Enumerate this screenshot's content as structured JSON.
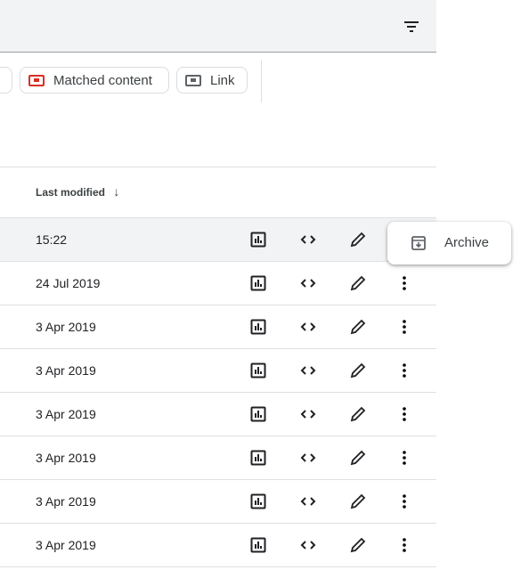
{
  "filters": {
    "chips": [
      {
        "label": "Matched content",
        "color": "#d93025"
      },
      {
        "label": "Link",
        "color": "#5f6368"
      }
    ]
  },
  "table": {
    "column_header": "Last modified",
    "sort": "descending",
    "rows": [
      {
        "date": "15:22"
      },
      {
        "date": "24 Jul 2019"
      },
      {
        "date": "3 Apr 2019"
      },
      {
        "date": "3 Apr 2019"
      },
      {
        "date": "3 Apr 2019"
      },
      {
        "date": "3 Apr 2019"
      },
      {
        "date": "3 Apr 2019"
      },
      {
        "date": "3 Apr 2019"
      }
    ]
  },
  "menu": {
    "archive_label": "Archive"
  }
}
